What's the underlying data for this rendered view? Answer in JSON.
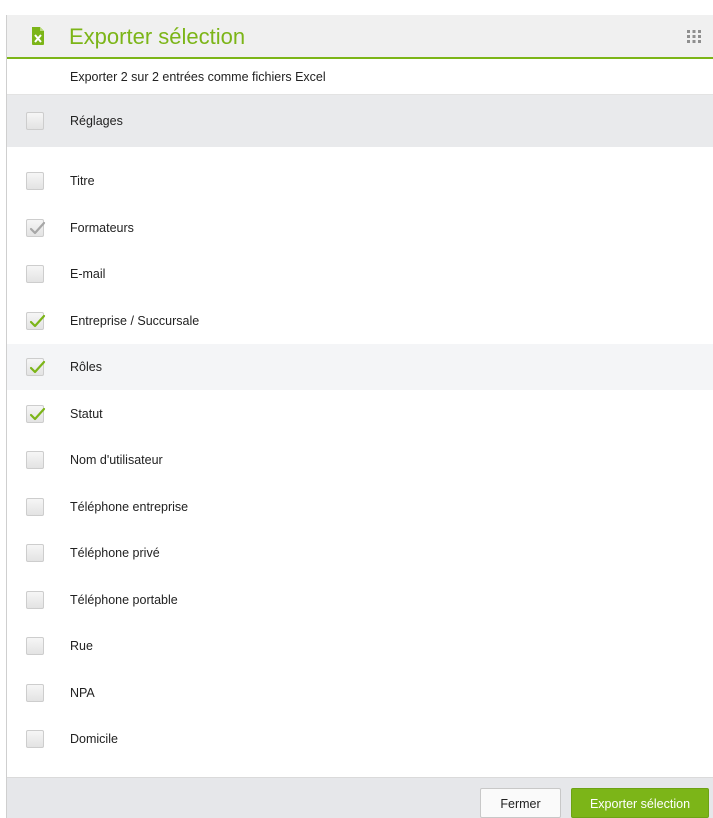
{
  "dialog": {
    "title": "Exporter sélection",
    "subtitle": "Exporter 2 sur 2 entrées comme fichiers Excel",
    "accent_color": "#7cb518",
    "header_icon": "excel-file-icon",
    "menu_icon": "grid-menu-icon"
  },
  "settings": {
    "label": "Réglages",
    "checked": false
  },
  "fields": [
    {
      "label": "Titre",
      "state": "unchecked"
    },
    {
      "label": "Formateurs",
      "state": "checked-disabled"
    },
    {
      "label": "E-mail",
      "state": "unchecked"
    },
    {
      "label": "Entreprise / Succursale",
      "state": "checked"
    },
    {
      "label": "Rôles",
      "state": "checked"
    },
    {
      "label": "Statut",
      "state": "checked"
    },
    {
      "label": "Nom d'utilisateur",
      "state": "unchecked"
    },
    {
      "label": "Téléphone entreprise",
      "state": "unchecked"
    },
    {
      "label": "Téléphone privé",
      "state": "unchecked"
    },
    {
      "label": "Téléphone portable",
      "state": "unchecked"
    },
    {
      "label": "Rue",
      "state": "unchecked"
    },
    {
      "label": "NPA",
      "state": "unchecked"
    },
    {
      "label": "Domicile",
      "state": "unchecked"
    }
  ],
  "footer": {
    "close_label": "Fermer",
    "export_label": "Exporter sélection"
  }
}
